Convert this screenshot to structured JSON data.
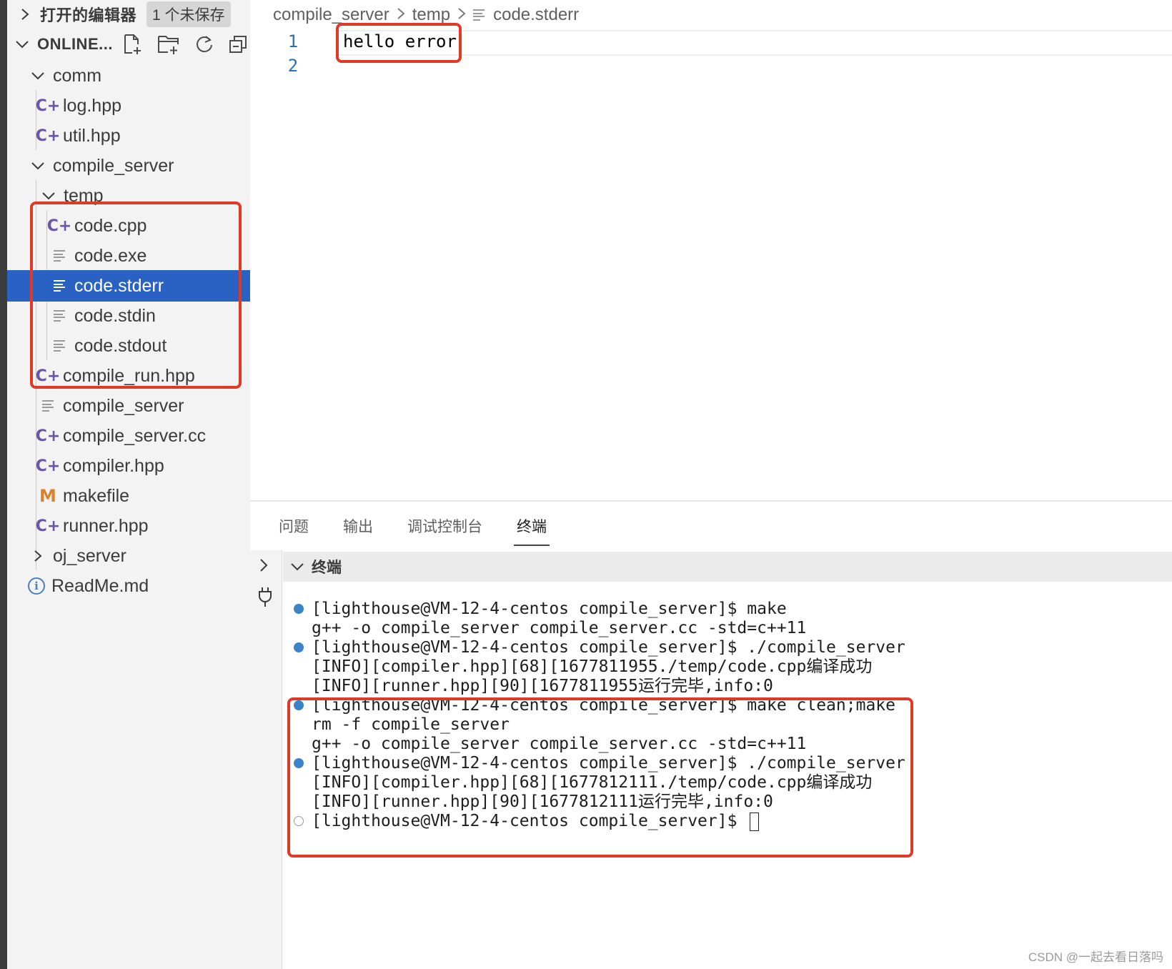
{
  "sidebar": {
    "open_editors": {
      "label": "打开的编辑器",
      "badge": "1 个未保存"
    },
    "project": {
      "label": "ONLINE..."
    },
    "tree": [
      {
        "label": "comm"
      },
      {
        "label": "log.hpp"
      },
      {
        "label": "util.hpp"
      },
      {
        "label": "compile_server"
      },
      {
        "label": "temp"
      },
      {
        "label": "code.cpp"
      },
      {
        "label": "code.exe"
      },
      {
        "label": "code.stderr"
      },
      {
        "label": "code.stdin"
      },
      {
        "label": "code.stdout"
      },
      {
        "label": "compile_run.hpp"
      },
      {
        "label": "compile_server"
      },
      {
        "label": "compile_server.cc"
      },
      {
        "label": "compiler.hpp"
      },
      {
        "label": "makefile"
      },
      {
        "label": "runner.hpp"
      },
      {
        "label": "oj_server"
      },
      {
        "label": "ReadMe.md"
      }
    ],
    "selected_file": "code.stderr"
  },
  "breadcrumb": [
    "compile_server",
    "temp",
    "code.stderr"
  ],
  "editor": {
    "line_numbers": [
      "1",
      "2"
    ],
    "lines": [
      "hello error",
      ""
    ]
  },
  "panel": {
    "tabs": [
      "问题",
      "输出",
      "调试控制台",
      "终端"
    ],
    "active_tab": "终端",
    "terminal_title": "终端",
    "terminal_lines": [
      "[lighthouse@VM-12-4-centos compile_server]$ make",
      "g++ -o compile_server compile_server.cc -std=c++11",
      "[lighthouse@VM-12-4-centos compile_server]$ ./compile_server",
      "[INFO][compiler.hpp][68][1677811955./temp/code.cpp编译成功",
      "[INFO][runner.hpp][90][1677811955运行完毕,info:0",
      "[lighthouse@VM-12-4-centos compile_server]$ make clean;make",
      "rm -f compile_server",
      "g++ -o compile_server compile_server.cc -std=c++11",
      "[lighthouse@VM-12-4-centos compile_server]$ ./compile_server",
      "[INFO][compiler.hpp][68][1677812111./temp/code.cpp编译成功",
      "[INFO][runner.hpp][90][1677812111运行完毕,info:0",
      "[lighthouse@VM-12-4-centos compile_server]$ "
    ]
  },
  "watermark": "CSDN @一起去看日落吗",
  "colors": {
    "selection": "#2a62c4",
    "highlight_box": "#e03a26",
    "line_number": "#2c6fb5",
    "terminal_dot": "#3a83c9",
    "cpp_icon": "#6a55a6",
    "makefile_icon": "#d9822b"
  }
}
